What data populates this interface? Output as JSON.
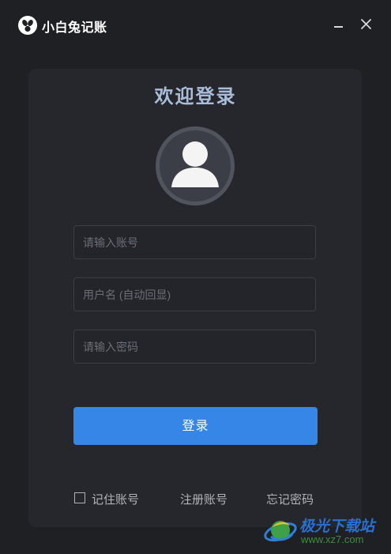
{
  "app": {
    "name": "小白兔记账"
  },
  "window": {
    "minimize_icon": "minimize-icon",
    "close_icon": "close-icon"
  },
  "login": {
    "title": "欢迎登录",
    "account_placeholder": "请输入账号",
    "username_placeholder": "用户名 (自动回显)",
    "password_placeholder": "请输入密码",
    "login_button": "登录",
    "remember_label": "记住账号",
    "register_link": "注册账号",
    "forgot_link": "忘记密码"
  },
  "watermark": {
    "title": "极光下载站",
    "url": "www.xz7.com"
  },
  "colors": {
    "background": "#1f2024",
    "panel": "#26272d",
    "accent": "#3586e6",
    "title": "#a9bdd8"
  }
}
